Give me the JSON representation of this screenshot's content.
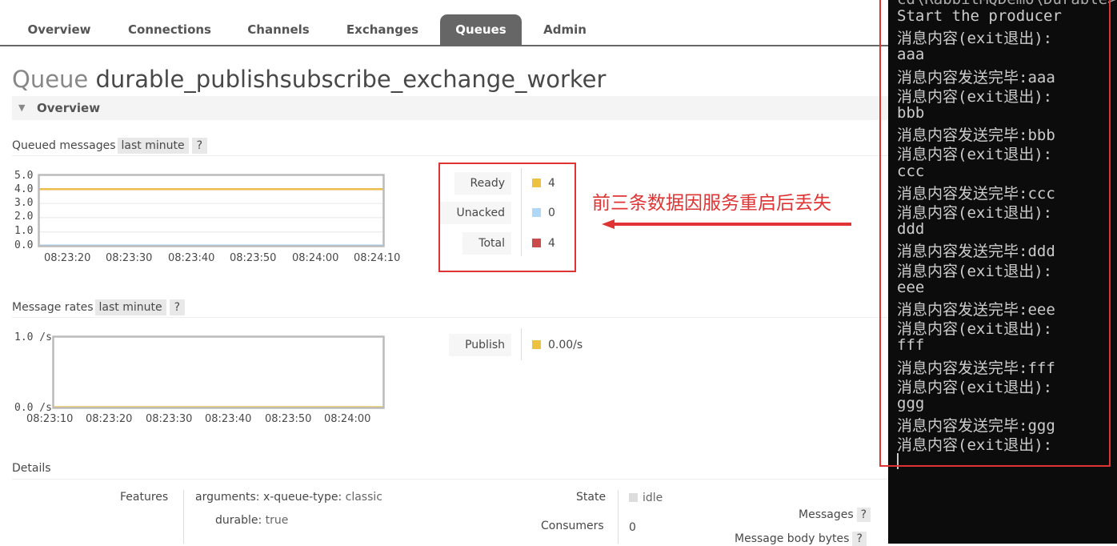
{
  "nav": {
    "tabs": [
      {
        "label": "Overview"
      },
      {
        "label": "Connections"
      },
      {
        "label": "Channels"
      },
      {
        "label": "Exchanges"
      },
      {
        "label": "Queues",
        "active": true
      },
      {
        "label": "Admin"
      }
    ]
  },
  "page": {
    "title_prefix": "Queue",
    "queue_name": "durable_publishsubscribe_exchange_worker"
  },
  "overview_section": {
    "label": "Overview"
  },
  "queued_messages": {
    "title": "Queued messages",
    "range": "last minute",
    "help": "?",
    "legend": [
      {
        "label": "Ready",
        "value": "4",
        "color": "#edc240"
      },
      {
        "label": "Unacked",
        "value": "0",
        "color": "#afd8f8"
      },
      {
        "label": "Total",
        "value": "4",
        "color": "#cb4b4b"
      }
    ]
  },
  "message_rates": {
    "title": "Message rates",
    "range": "last minute",
    "help": "?",
    "legend": [
      {
        "label": "Publish",
        "value": "0.00/s",
        "color": "#edc240"
      }
    ]
  },
  "annotation": "前三条数据因服务重启后丢失",
  "details": {
    "title": "Details",
    "features_label": "Features",
    "arguments_key": "arguments:",
    "arguments_sub_key": "x-queue-type:",
    "arguments_sub_value": "classic",
    "durable_key": "durable:",
    "durable_value": "true",
    "state_label": "State",
    "state_value": "idle",
    "consumers_label": "Consumers",
    "consumers_value": "0",
    "messages_label": "Messages",
    "messages_help": "?",
    "body_bytes_label": "Message body bytes",
    "body_bytes_help": "?"
  },
  "chart_data": [
    {
      "type": "line",
      "x": [
        "08:23:20",
        "08:23:30",
        "08:23:40",
        "08:23:50",
        "08:24:00",
        "08:24:10"
      ],
      "y_ticks": [
        "5.0",
        "4.0",
        "3.0",
        "2.0",
        "1.0",
        "0.0"
      ],
      "ylim": [
        0,
        5
      ],
      "series": [
        {
          "name": "Total",
          "color": "#cb4b4b",
          "values": [
            4,
            4,
            4,
            4,
            4,
            4
          ]
        },
        {
          "name": "Unacked",
          "color": "#afd8f8",
          "values": [
            0,
            0,
            0,
            0,
            0,
            0
          ]
        },
        {
          "name": "Ready",
          "color": "#edc240",
          "values": [
            4,
            4,
            4,
            4,
            4,
            4
          ]
        }
      ]
    },
    {
      "type": "line",
      "x": [
        "08:23:10",
        "08:23:20",
        "08:23:30",
        "08:23:40",
        "08:23:50",
        "08:24:00"
      ],
      "y_ticks": [
        "1.0 /s",
        "0.0 /s"
      ],
      "ylim": [
        0,
        1
      ],
      "series": [
        {
          "name": "Publish",
          "color": "#edc240",
          "values": [
            0,
            0,
            0,
            0,
            0,
            0
          ]
        }
      ]
    }
  ],
  "terminal": {
    "lines": [
      "Start the producer",
      "消息内容(exit退出):",
      "aaa",
      "消息内容发送完毕:aaa",
      "消息内容(exit退出):",
      "bbb",
      "消息内容发送完毕:bbb",
      "消息内容(exit退出):",
      "ccc",
      "消息内容发送完毕:ccc",
      "消息内容(exit退出):",
      "ddd",
      "消息内容发送完毕:ddd",
      "消息内容(exit退出):",
      "eee",
      "消息内容发送完毕:eee",
      "消息内容(exit退出):",
      "fff",
      "消息内容发送完毕:fff",
      "消息内容(exit退出):",
      "ggg",
      "消息内容发送完毕:ggg",
      "消息内容(exit退出):"
    ]
  }
}
